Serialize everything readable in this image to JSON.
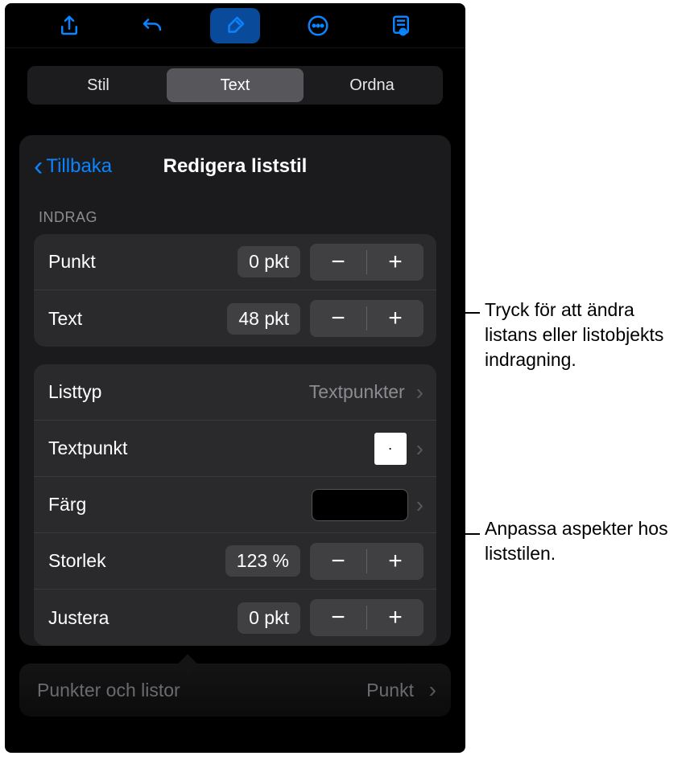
{
  "tabs": {
    "stil": "Stil",
    "text": "Text",
    "ordna": "Ordna"
  },
  "back_label": "Tillbaka",
  "panel_title": "Redigera liststil",
  "section_indrag": "INDRAG",
  "indent": {
    "punkt_label": "Punkt",
    "punkt_value": "0 pkt",
    "text_label": "Text",
    "text_value": "48 pkt"
  },
  "style": {
    "listtyp_label": "Listtyp",
    "listtyp_value": "Textpunkter",
    "textpunkt_label": "Textpunkt",
    "farg_label": "Färg",
    "storlek_label": "Storlek",
    "storlek_value": "123 %",
    "justera_label": "Justera",
    "justera_value": "0 pkt"
  },
  "ghost": {
    "label": "Punkter och listor",
    "value": "Punkt"
  },
  "callouts": {
    "c1": "Tryck för att ändra listans eller listobjekts indragning.",
    "c2": "Anpassa aspekter hos liststilen."
  },
  "glyphs": {
    "minus": "−",
    "plus": "+",
    "chevron_right": "›",
    "dot": "·"
  }
}
